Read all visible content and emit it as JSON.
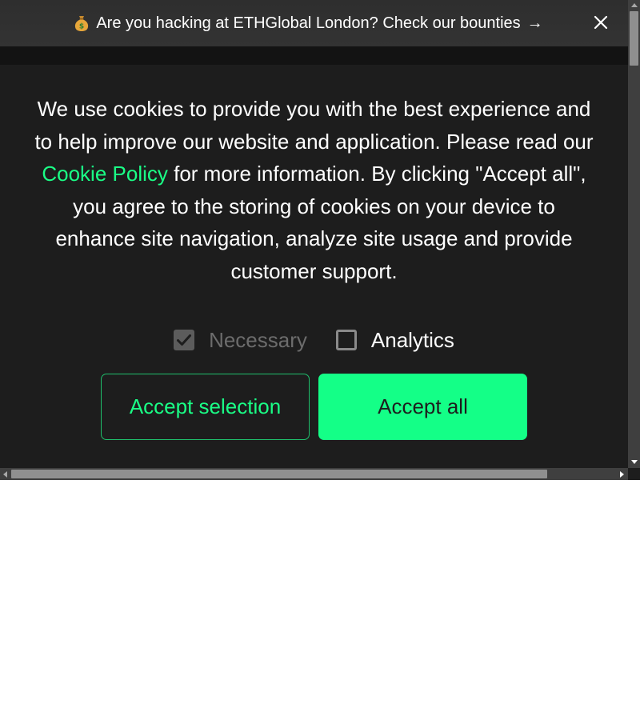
{
  "banner": {
    "icon": "money-bag-icon",
    "text": "Are you hacking at ETHGlobal London? Check our bounties",
    "arrow": "→",
    "close_icon": "close-icon"
  },
  "cookie": {
    "text_before": "We use cookies to provide you with the best experience and to help improve our website and application. Please read our ",
    "link_text": "Cookie Policy",
    "text_after": " for more information. By clicking \"Accept all\", you agree to the storing of cookies on your device to enhance site navigation, analyze site usage and provide customer support."
  },
  "options": {
    "necessary": {
      "label": "Necessary",
      "checked": true,
      "disabled": true
    },
    "analytics": {
      "label": "Analytics",
      "checked": false,
      "disabled": false
    }
  },
  "buttons": {
    "accept_selection": "Accept selection",
    "accept_all": "Accept all"
  },
  "colors": {
    "background": "#1d1d1d",
    "banner": "#333333",
    "accent": "#14ff87",
    "link": "#1aff86",
    "text": "#ffffff",
    "disabled_text": "#6c6c6c"
  }
}
